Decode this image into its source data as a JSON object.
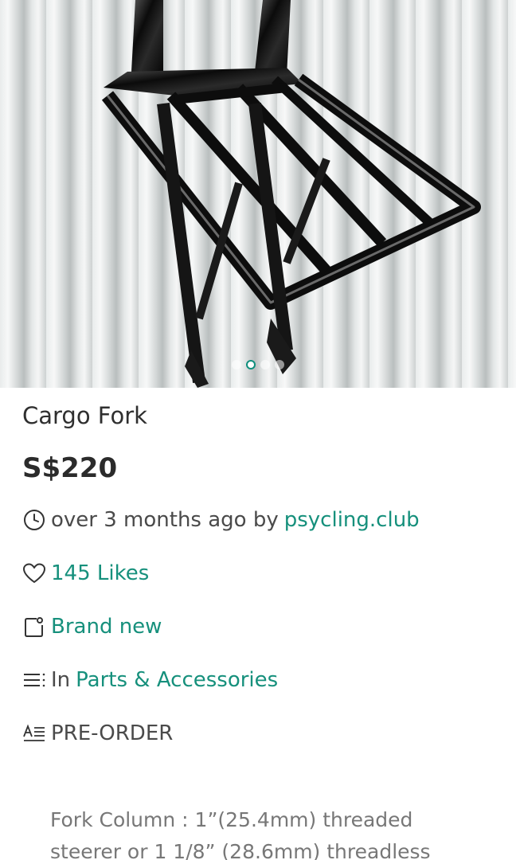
{
  "listing": {
    "title": "Cargo Fork",
    "price": "S$220"
  },
  "gallery": {
    "image_alt": "black cargo fork with front rack",
    "dot_count": 4,
    "active_index": 1
  },
  "meta": {
    "time_text": "over 3 months ago by",
    "seller": "psycling.club",
    "likes": "145 Likes",
    "condition": "Brand new",
    "category_prefix": "In",
    "category": "Parts & Accessories",
    "tag": "PRE-ORDER"
  },
  "description": {
    "line1": "Fork Column : 1”(25.4mm) threaded",
    "line2": "steerer or 1 1/8” (28.6mm) threadless"
  },
  "icons": {
    "time": "clock-icon",
    "likes": "heart-icon",
    "condition": "tag-icon",
    "category": "list-icon",
    "tag": "text-style-icon"
  },
  "colors": {
    "accent": "#16907c",
    "text": "#2b2b2b",
    "muted": "#777777"
  }
}
